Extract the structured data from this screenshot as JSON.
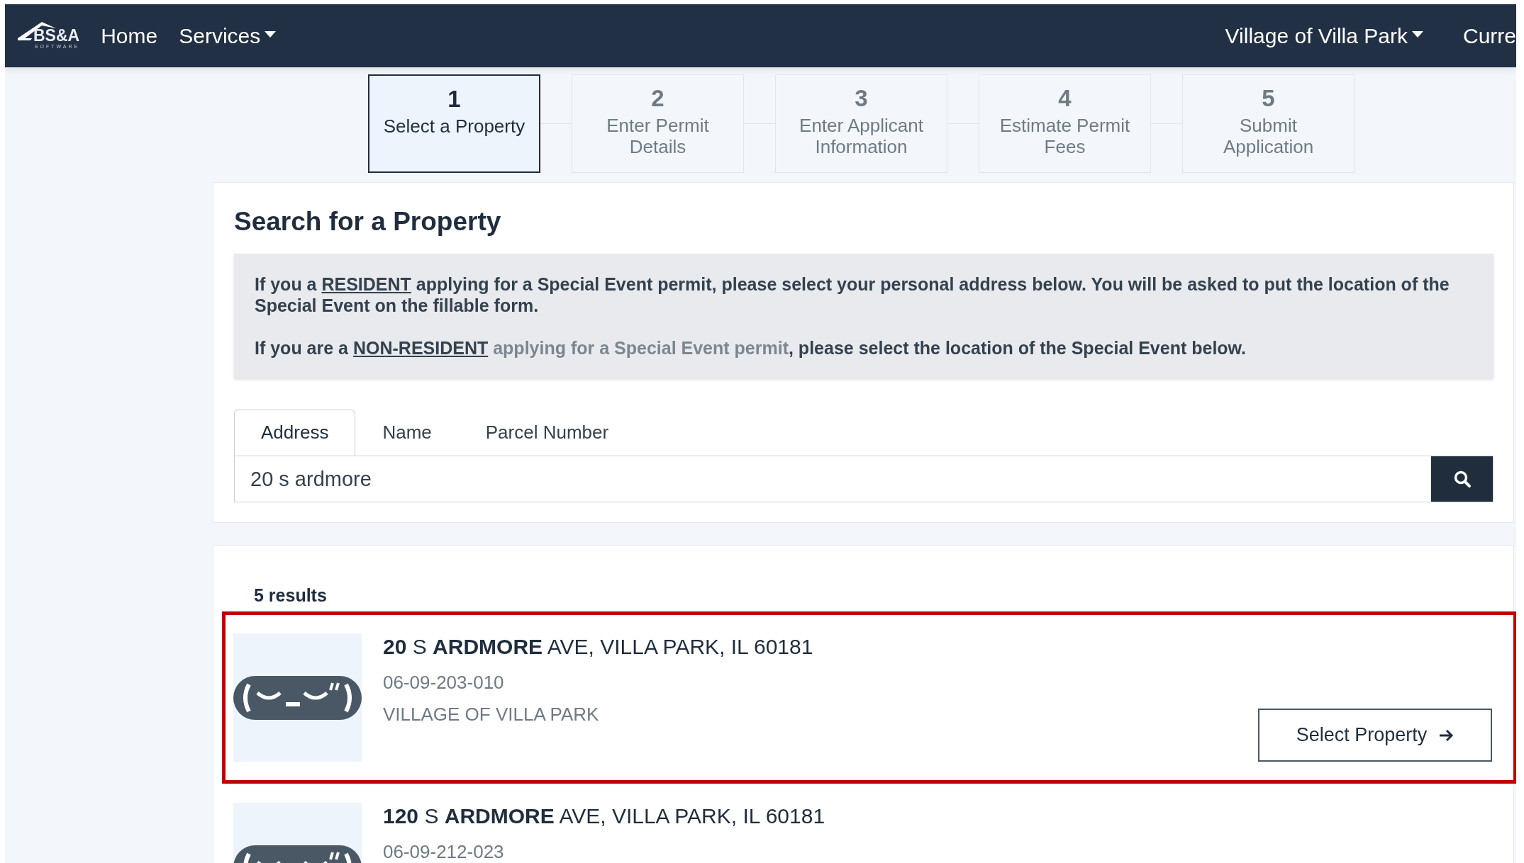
{
  "navbar": {
    "logo": {
      "name": "BS&A",
      "tagline": "SOFTWARE"
    },
    "links": [
      {
        "label": "Home",
        "dropdown": false
      },
      {
        "label": "Services",
        "dropdown": true
      }
    ],
    "right_links": [
      {
        "label": "Village of Villa Park",
        "dropdown": true
      },
      {
        "label": "Curre",
        "dropdown": false
      }
    ]
  },
  "steps": [
    {
      "number": "1",
      "label": "Select a Property",
      "selected": true
    },
    {
      "number": "2",
      "label": "Enter Permit Details",
      "selected": false
    },
    {
      "number": "3",
      "label": "Enter Applicant Information",
      "selected": false
    },
    {
      "number": "4",
      "label": "Estimate Permit Fees",
      "selected": false
    },
    {
      "number": "5",
      "label": "Submit Application",
      "selected": false
    }
  ],
  "search_panel": {
    "title": "Search for a Property",
    "notice": [
      [
        {
          "kind": "text",
          "text": "If you a "
        },
        {
          "kind": "link",
          "text": "RESIDENT"
        },
        {
          "kind": "text",
          "text": " applying for a Special Event permit, please select your personal address below. You will be asked to put the location of the Special Event on the fillable form."
        }
      ],
      [
        {
          "kind": "text",
          "text": "If you are a "
        },
        {
          "kind": "link",
          "text": "NON-RESIDENT"
        },
        {
          "kind": "muted",
          "text": " applying for a Special Event permit"
        },
        {
          "kind": "text",
          "text": ", please select the location of the Special Event below."
        }
      ]
    ],
    "tabs": [
      {
        "label": "Address",
        "selected": true
      },
      {
        "label": "Name",
        "selected": false
      },
      {
        "label": "Parcel Number",
        "selected": false
      }
    ],
    "search_value": "20 s ardmore"
  },
  "results": {
    "count": "5 results",
    "items": [
      {
        "address": "**20** S **ARDMORE** AVE, VILLA PARK, IL 60181",
        "parcel": "06-09-203-010",
        "owner": "VILLAGE OF VILLA PARK",
        "button": "Select Property",
        "highlighted": true
      },
      {
        "address": "**120** S **ARDMORE** AVE, VILLA PARK, IL 60181",
        "parcel": "06-09-212-023",
        "highlighted": false
      }
    ]
  }
}
